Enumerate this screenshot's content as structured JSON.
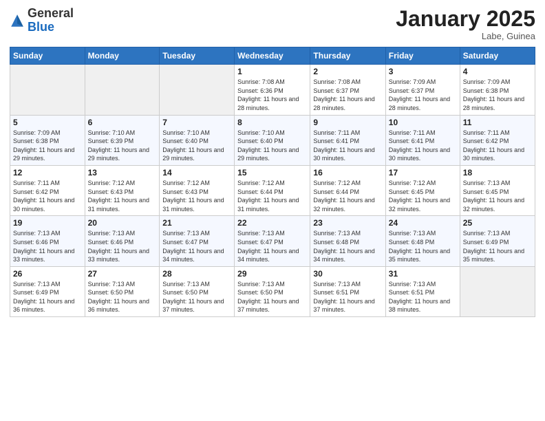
{
  "header": {
    "logo_general": "General",
    "logo_blue": "Blue",
    "month_title": "January 2025",
    "location": "Labe, Guinea"
  },
  "weekdays": [
    "Sunday",
    "Monday",
    "Tuesday",
    "Wednesday",
    "Thursday",
    "Friday",
    "Saturday"
  ],
  "weeks": [
    [
      {
        "day": "",
        "sunrise": "",
        "sunset": "",
        "daylight": ""
      },
      {
        "day": "",
        "sunrise": "",
        "sunset": "",
        "daylight": ""
      },
      {
        "day": "",
        "sunrise": "",
        "sunset": "",
        "daylight": ""
      },
      {
        "day": "1",
        "sunrise": "Sunrise: 7:08 AM",
        "sunset": "Sunset: 6:36 PM",
        "daylight": "Daylight: 11 hours and 28 minutes."
      },
      {
        "day": "2",
        "sunrise": "Sunrise: 7:08 AM",
        "sunset": "Sunset: 6:37 PM",
        "daylight": "Daylight: 11 hours and 28 minutes."
      },
      {
        "day": "3",
        "sunrise": "Sunrise: 7:09 AM",
        "sunset": "Sunset: 6:37 PM",
        "daylight": "Daylight: 11 hours and 28 minutes."
      },
      {
        "day": "4",
        "sunrise": "Sunrise: 7:09 AM",
        "sunset": "Sunset: 6:38 PM",
        "daylight": "Daylight: 11 hours and 28 minutes."
      }
    ],
    [
      {
        "day": "5",
        "sunrise": "Sunrise: 7:09 AM",
        "sunset": "Sunset: 6:38 PM",
        "daylight": "Daylight: 11 hours and 29 minutes."
      },
      {
        "day": "6",
        "sunrise": "Sunrise: 7:10 AM",
        "sunset": "Sunset: 6:39 PM",
        "daylight": "Daylight: 11 hours and 29 minutes."
      },
      {
        "day": "7",
        "sunrise": "Sunrise: 7:10 AM",
        "sunset": "Sunset: 6:40 PM",
        "daylight": "Daylight: 11 hours and 29 minutes."
      },
      {
        "day": "8",
        "sunrise": "Sunrise: 7:10 AM",
        "sunset": "Sunset: 6:40 PM",
        "daylight": "Daylight: 11 hours and 29 minutes."
      },
      {
        "day": "9",
        "sunrise": "Sunrise: 7:11 AM",
        "sunset": "Sunset: 6:41 PM",
        "daylight": "Daylight: 11 hours and 30 minutes."
      },
      {
        "day": "10",
        "sunrise": "Sunrise: 7:11 AM",
        "sunset": "Sunset: 6:41 PM",
        "daylight": "Daylight: 11 hours and 30 minutes."
      },
      {
        "day": "11",
        "sunrise": "Sunrise: 7:11 AM",
        "sunset": "Sunset: 6:42 PM",
        "daylight": "Daylight: 11 hours and 30 minutes."
      }
    ],
    [
      {
        "day": "12",
        "sunrise": "Sunrise: 7:11 AM",
        "sunset": "Sunset: 6:42 PM",
        "daylight": "Daylight: 11 hours and 30 minutes."
      },
      {
        "day": "13",
        "sunrise": "Sunrise: 7:12 AM",
        "sunset": "Sunset: 6:43 PM",
        "daylight": "Daylight: 11 hours and 31 minutes."
      },
      {
        "day": "14",
        "sunrise": "Sunrise: 7:12 AM",
        "sunset": "Sunset: 6:43 PM",
        "daylight": "Daylight: 11 hours and 31 minutes."
      },
      {
        "day": "15",
        "sunrise": "Sunrise: 7:12 AM",
        "sunset": "Sunset: 6:44 PM",
        "daylight": "Daylight: 11 hours and 31 minutes."
      },
      {
        "day": "16",
        "sunrise": "Sunrise: 7:12 AM",
        "sunset": "Sunset: 6:44 PM",
        "daylight": "Daylight: 11 hours and 32 minutes."
      },
      {
        "day": "17",
        "sunrise": "Sunrise: 7:12 AM",
        "sunset": "Sunset: 6:45 PM",
        "daylight": "Daylight: 11 hours and 32 minutes."
      },
      {
        "day": "18",
        "sunrise": "Sunrise: 7:13 AM",
        "sunset": "Sunset: 6:45 PM",
        "daylight": "Daylight: 11 hours and 32 minutes."
      }
    ],
    [
      {
        "day": "19",
        "sunrise": "Sunrise: 7:13 AM",
        "sunset": "Sunset: 6:46 PM",
        "daylight": "Daylight: 11 hours and 33 minutes."
      },
      {
        "day": "20",
        "sunrise": "Sunrise: 7:13 AM",
        "sunset": "Sunset: 6:46 PM",
        "daylight": "Daylight: 11 hours and 33 minutes."
      },
      {
        "day": "21",
        "sunrise": "Sunrise: 7:13 AM",
        "sunset": "Sunset: 6:47 PM",
        "daylight": "Daylight: 11 hours and 34 minutes."
      },
      {
        "day": "22",
        "sunrise": "Sunrise: 7:13 AM",
        "sunset": "Sunset: 6:47 PM",
        "daylight": "Daylight: 11 hours and 34 minutes."
      },
      {
        "day": "23",
        "sunrise": "Sunrise: 7:13 AM",
        "sunset": "Sunset: 6:48 PM",
        "daylight": "Daylight: 11 hours and 34 minutes."
      },
      {
        "day": "24",
        "sunrise": "Sunrise: 7:13 AM",
        "sunset": "Sunset: 6:48 PM",
        "daylight": "Daylight: 11 hours and 35 minutes."
      },
      {
        "day": "25",
        "sunrise": "Sunrise: 7:13 AM",
        "sunset": "Sunset: 6:49 PM",
        "daylight": "Daylight: 11 hours and 35 minutes."
      }
    ],
    [
      {
        "day": "26",
        "sunrise": "Sunrise: 7:13 AM",
        "sunset": "Sunset: 6:49 PM",
        "daylight": "Daylight: 11 hours and 36 minutes."
      },
      {
        "day": "27",
        "sunrise": "Sunrise: 7:13 AM",
        "sunset": "Sunset: 6:50 PM",
        "daylight": "Daylight: 11 hours and 36 minutes."
      },
      {
        "day": "28",
        "sunrise": "Sunrise: 7:13 AM",
        "sunset": "Sunset: 6:50 PM",
        "daylight": "Daylight: 11 hours and 37 minutes."
      },
      {
        "day": "29",
        "sunrise": "Sunrise: 7:13 AM",
        "sunset": "Sunset: 6:50 PM",
        "daylight": "Daylight: 11 hours and 37 minutes."
      },
      {
        "day": "30",
        "sunrise": "Sunrise: 7:13 AM",
        "sunset": "Sunset: 6:51 PM",
        "daylight": "Daylight: 11 hours and 37 minutes."
      },
      {
        "day": "31",
        "sunrise": "Sunrise: 7:13 AM",
        "sunset": "Sunset: 6:51 PM",
        "daylight": "Daylight: 11 hours and 38 minutes."
      },
      {
        "day": "",
        "sunrise": "",
        "sunset": "",
        "daylight": ""
      }
    ]
  ]
}
